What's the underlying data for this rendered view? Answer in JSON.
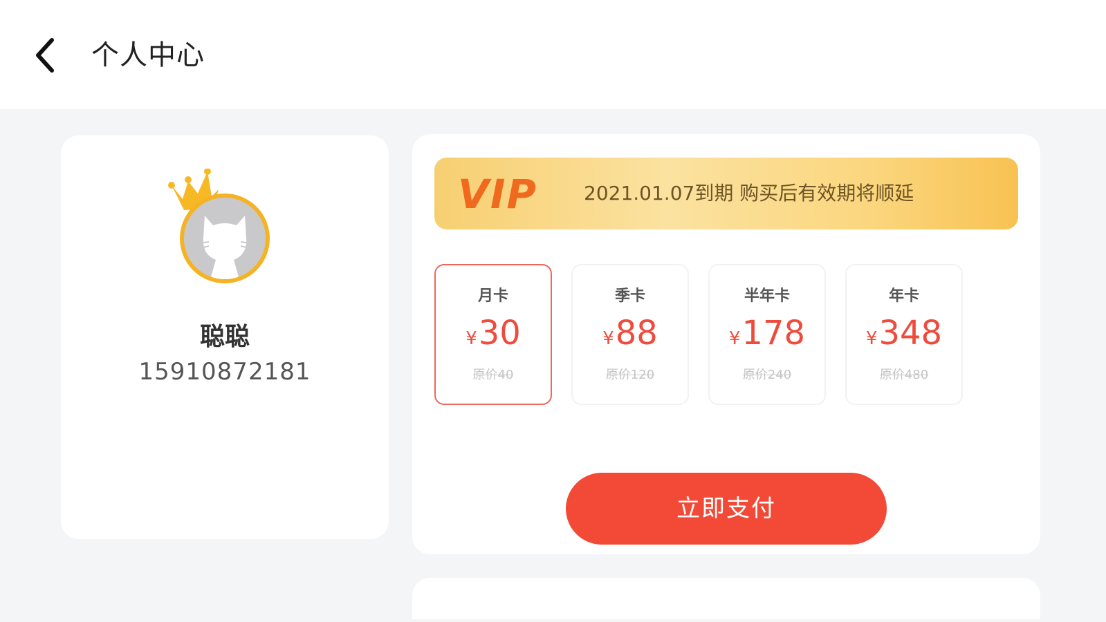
{
  "header": {
    "back_icon": "chevron-left-icon",
    "title": "个人中心"
  },
  "profile": {
    "avatar_icon": "cat-avatar-icon",
    "badge_icon": "crown-icon",
    "name": "聪聪",
    "phone": "15910872181"
  },
  "vip": {
    "logo": "VIP",
    "expiry_text": "2021.01.07到期 购买后有效期将顺延",
    "plans": [
      {
        "name": "月卡",
        "currency": "¥",
        "price": "30",
        "original": "原价40",
        "selected": true
      },
      {
        "name": "季卡",
        "currency": "¥",
        "price": "88",
        "original": "原价120",
        "selected": false
      },
      {
        "name": "半年卡",
        "currency": "¥",
        "price": "178",
        "original": "原价240",
        "selected": false
      },
      {
        "name": "年卡",
        "currency": "¥",
        "price": "348",
        "original": "原价480",
        "selected": false
      }
    ],
    "pay_label": "立即支付"
  },
  "colors": {
    "accent": "#f24a36",
    "vip_gold": "#f7cf72",
    "crown": "#f5b324"
  }
}
